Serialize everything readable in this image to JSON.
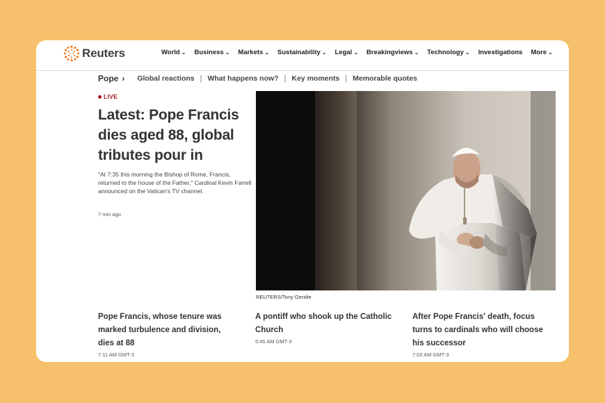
{
  "brand": {
    "name": "Reuters",
    "logo_icon": "reuters-dot-ring-logo",
    "accent": "#fa6400"
  },
  "nav": [
    {
      "label": "World",
      "dropdown": true
    },
    {
      "label": "Business",
      "dropdown": true
    },
    {
      "label": "Markets",
      "dropdown": true
    },
    {
      "label": "Sustainability",
      "dropdown": true
    },
    {
      "label": "Legal",
      "dropdown": true
    },
    {
      "label": "Breakingviews",
      "dropdown": true
    },
    {
      "label": "Technology",
      "dropdown": true
    },
    {
      "label": "Investigations",
      "dropdown": false
    },
    {
      "label": "More",
      "dropdown": true
    }
  ],
  "subnav": {
    "section": "Pope",
    "links": [
      "Global reactions",
      "What happens now?",
      "Key moments",
      "Memorable quotes"
    ]
  },
  "main_story": {
    "badge": "LIVE",
    "badge_color": "#a0121b",
    "headline": "Latest: Pope Francis dies aged 88, global tributes pour in",
    "summary": "\"At 7:35 this morning the Bishop of Rome, Francis, returned to the house of the Father,\" Cardinal Kevin Farrell announced on the Vatican's TV channel.",
    "time": "7 min ago"
  },
  "photo": {
    "caption": "REUTERS/Tony Gentile"
  },
  "stories": [
    {
      "title": "Pope Francis, whose tenure was marked turbulence and division, dies at 88",
      "time": "7:11 AM GMT-3"
    },
    {
      "title": "A pontiff who shook up the Catholic Church",
      "time": "5:45 AM GMT-3"
    },
    {
      "title": "After Pope Francis' death, focus turns to cardinals who will choose his successor",
      "time": "7:03 AM GMT-3"
    }
  ]
}
